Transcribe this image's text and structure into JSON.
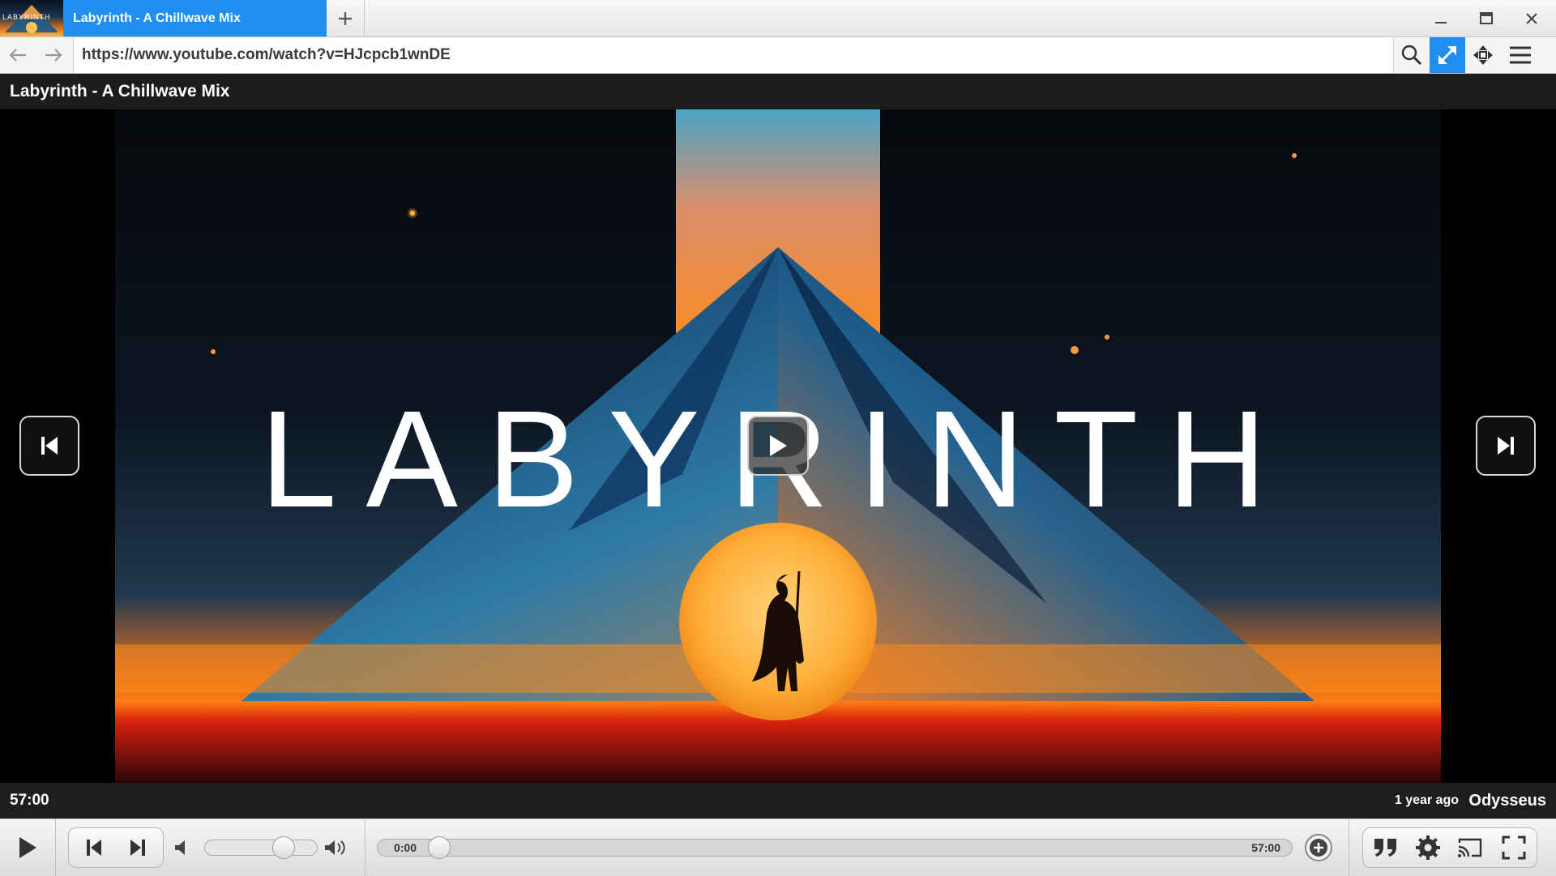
{
  "tab": {
    "title": "Labyrinth - A Chillwave Mix",
    "thumb_text": "LABYRINTH",
    "new_tab_icon": "plus-icon"
  },
  "window": {
    "minimize_icon": "minimize-icon",
    "maximize_icon": "maximize-icon",
    "close_icon": "close-icon"
  },
  "address": {
    "url": "https://www.youtube.com/watch?v=HJcpcb1wnDE",
    "back_icon": "arrow-left-icon",
    "forward_icon": "arrow-right-icon"
  },
  "toolbar": {
    "search_icon": "search-icon",
    "expand_icon": "expand-arrows-icon",
    "move_icon": "move-arrows-icon",
    "menu_icon": "hamburger-menu-icon",
    "accent": "#1e8ef0"
  },
  "video": {
    "title": "Labyrinth - A Chillwave Mix",
    "artwork_text": "LABYRINTH",
    "duration": "57:00",
    "uploaded": "1 year ago",
    "channel": "Odysseus"
  },
  "controls": {
    "current_time": "0:00",
    "total_time": "57:00",
    "progress": 0.0,
    "volume": 0.75
  }
}
